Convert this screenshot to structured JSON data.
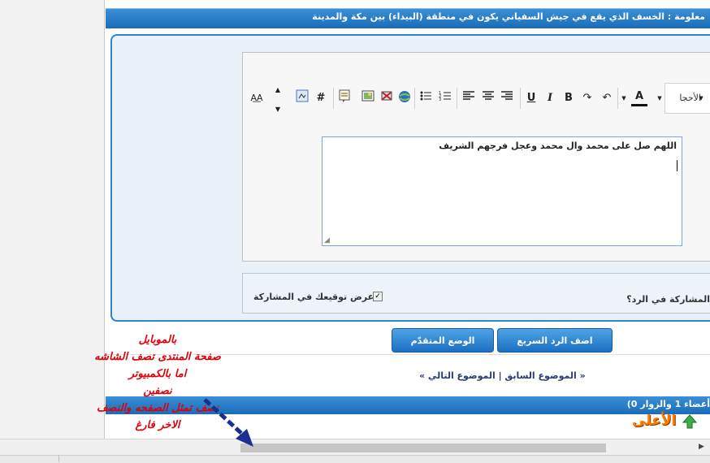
{
  "thread": {
    "title": "معلومة : الخسف الذي يقع في جيش السفياني يكون في منطقة (البيداء) بين مكة والمدينة"
  },
  "editor": {
    "font_name": "الأحجا",
    "message": "اللهم صل على محمد وال محمد وعجل فرجهم الشريف",
    "tools": [
      "text-direction-icon",
      "font-size-up-icon",
      "font-size-down-icon",
      "source-icon",
      "hash-icon",
      "quote-icon",
      "image-icon",
      "video-icon",
      "link-icon",
      "bullet-list-icon",
      "number-list-icon",
      "align-left-icon",
      "align-center-icon",
      "align-right-icon",
      "underline-icon",
      "italic-icon",
      "bold-icon",
      "redo-icon",
      "undo-icon",
      "font-color-icon"
    ]
  },
  "options": {
    "show_signature": "عرض توقيعك في المشاركة",
    "quote_post": "المشاركة في الرد؟"
  },
  "buttons": {
    "advanced": "الوضع المتقدّم",
    "quick_reply": "اضف الرد السريع"
  },
  "nav": {
    "text": "« الموضوع السابق | الموضوع التالي »"
  },
  "online": {
    "text": "أعضاء 1 والزوار 0)"
  },
  "top_link": {
    "label": "الأعلى"
  },
  "annotation": {
    "line1": "بالموبايل",
    "line2": "صفحة المنتدى تصف الشاشه",
    "line3": "اما بالكمبيوتر",
    "line4": "نصفين",
    "line5": "نصف تمثل الصفحه والنصف",
    "line6": "الاخر فارغ"
  },
  "colors": {
    "accent_blue": "#1a6cb8",
    "annotation_red": "#e0000a",
    "top_link_orange": "#ff7b00"
  }
}
